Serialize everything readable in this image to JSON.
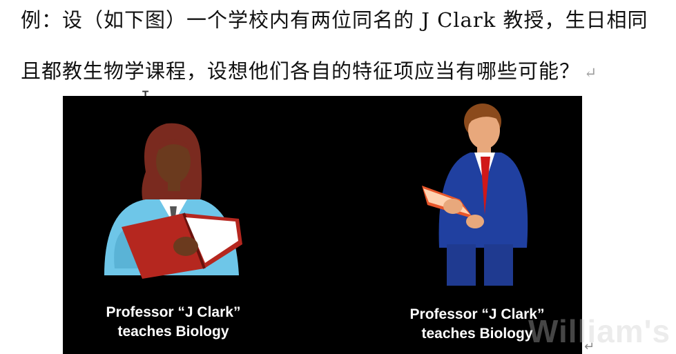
{
  "paragraph": {
    "line1": "例：设（如下图）一个学校内有两位同名的 J  Clark 教授，生日相同",
    "line2": "且都教生物学课程，设想他们各自的特征项应当有哪些可能？",
    "paragraph_mark": "↵",
    "end_mark": "↵",
    "text_cursor": "I"
  },
  "figure": {
    "background": "#000000",
    "left_caption": {
      "line1": "Professor “J Clark”",
      "line2": "teaches Biology"
    },
    "right_caption": {
      "line1": "Professor “J Clark”",
      "line2": "teaches Biology"
    },
    "watermark": "William's"
  }
}
